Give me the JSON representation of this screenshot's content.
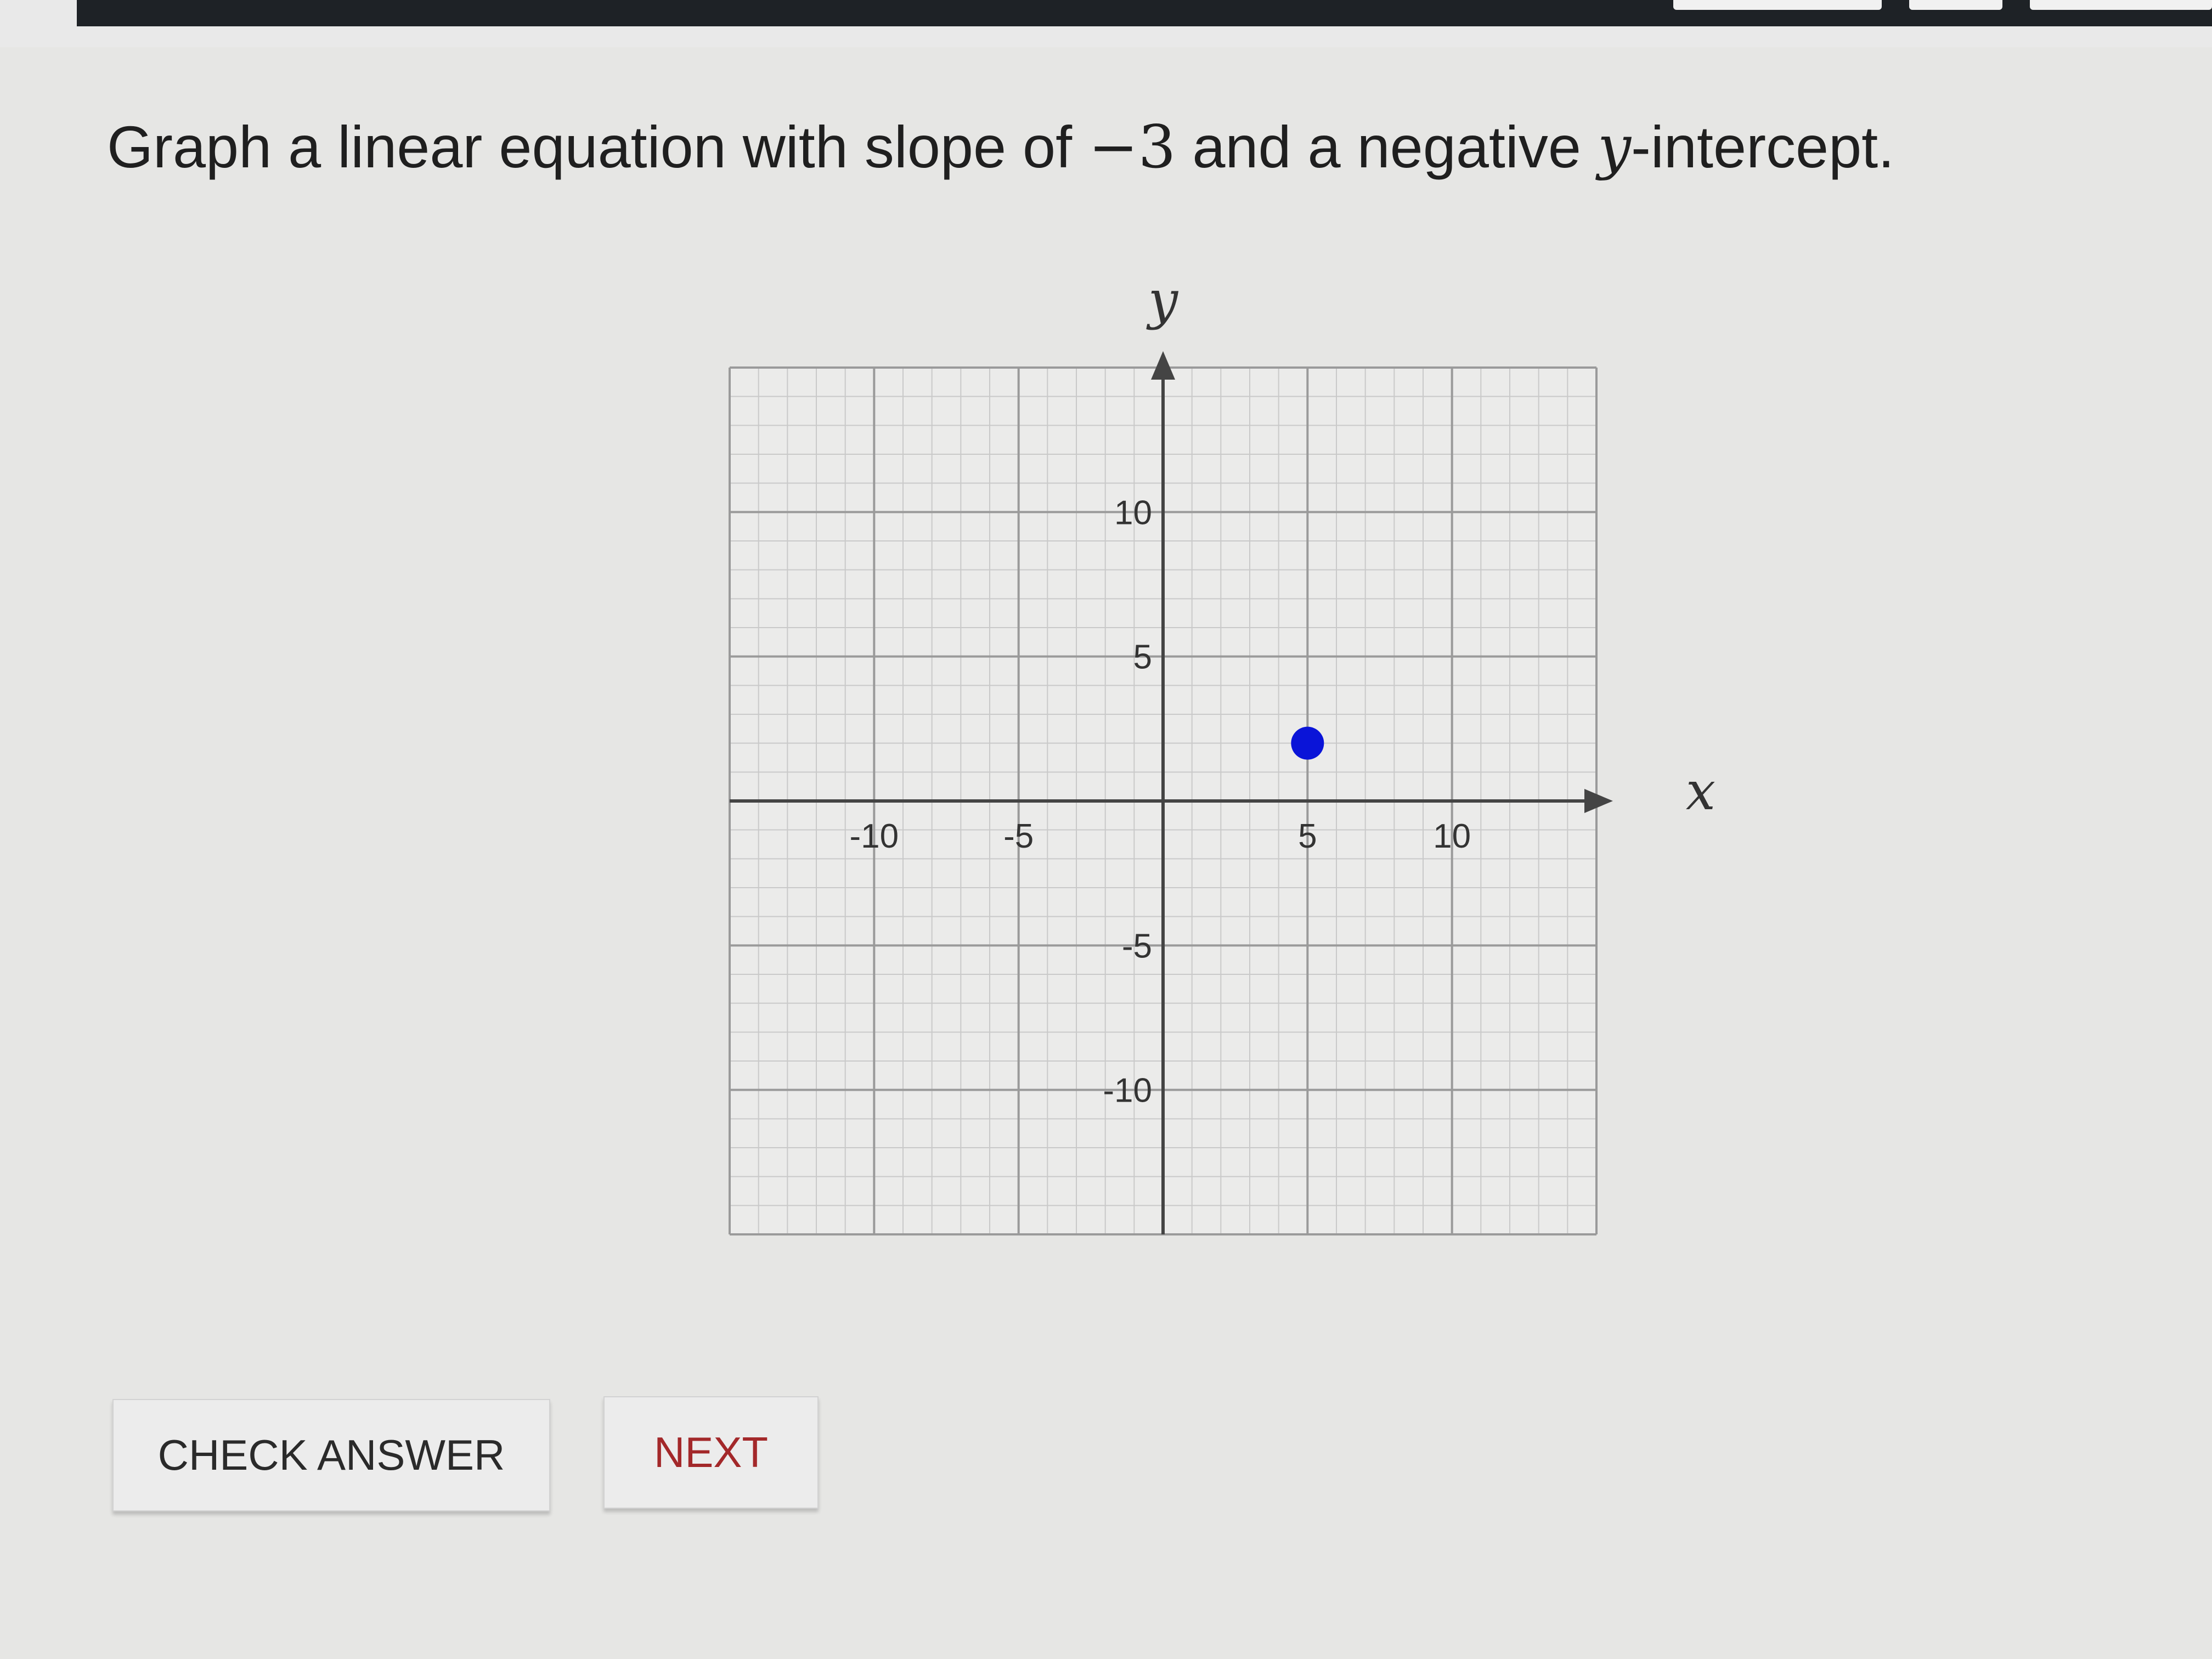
{
  "question": {
    "text_before": "Graph a linear equation with slope of ",
    "slope_value": "−3",
    "text_middle": " and a negative ",
    "variable": "y",
    "text_after": "-intercept."
  },
  "graph": {
    "x_axis_label": "x",
    "y_axis_label": "y",
    "x_range": [
      -15,
      15
    ],
    "y_range": [
      -15,
      15
    ],
    "minor_grid_step": 1,
    "major_grid_step": 5,
    "x_tick_labels": [
      {
        "value": -10,
        "text": "-10"
      },
      {
        "value": -5,
        "text": "-5"
      },
      {
        "value": 5,
        "text": "5"
      },
      {
        "value": 10,
        "text": "10"
      }
    ],
    "y_tick_labels": [
      {
        "value": 10,
        "text": "10"
      },
      {
        "value": 5,
        "text": "5"
      },
      {
        "value": -5,
        "text": "-5"
      },
      {
        "value": -10,
        "text": "-10"
      }
    ],
    "plotted_points": [
      {
        "x": 5,
        "y": 2
      }
    ],
    "point_color": "#0a14d8",
    "axis_color": "#444444",
    "minor_grid_color": "#c9c9c9",
    "major_grid_color": "#9a9a9a"
  },
  "buttons": {
    "check_answer": "CHECK ANSWER",
    "next": "NEXT"
  },
  "colors": {
    "next_text": "#a3282a",
    "page_background": "#e6e6e4",
    "top_bar": "#1e2226"
  }
}
